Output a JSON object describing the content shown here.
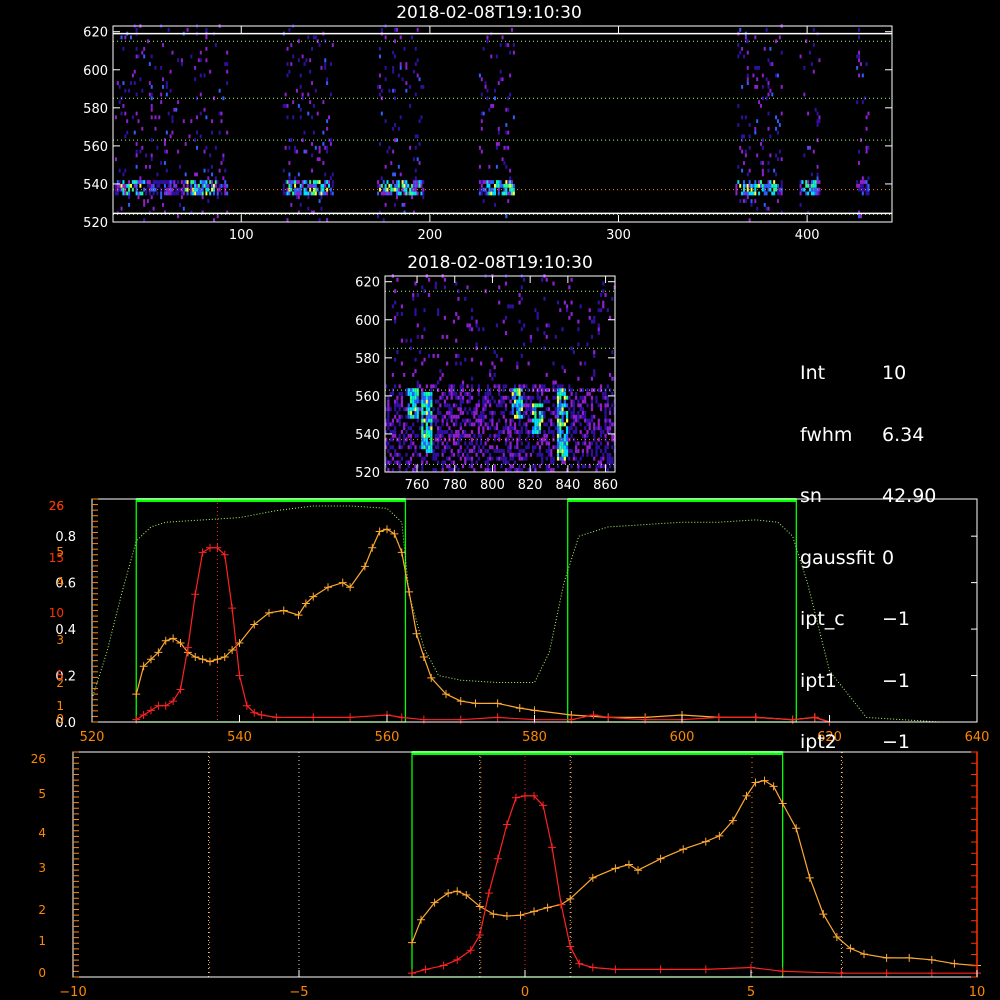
{
  "colors": {
    "background": "#000000",
    "axis": "#ffffff",
    "grid_dotted_green": "#9aff66",
    "grid_dotted_orange": "#ff8800",
    "window_green": "#00ff00",
    "red_profile": "#ff2222",
    "orange_profile": "#ffaa33",
    "green_dotted_profile": "#aaff66",
    "right_axis_red": "#ff3300",
    "left_axis_orange": "#ff8800",
    "heat_low": "#3010a0",
    "heat_mid": "#9020d0",
    "heat_high": "#00e0ff",
    "heat_peak": "#ffff40"
  },
  "info_panel": [
    {
      "key": "Int",
      "value": "10"
    },
    {
      "key": "fwhm",
      "value": "6.34"
    },
    {
      "key": "sn",
      "value": "42.90"
    },
    {
      "key": "gaussfit",
      "value": "0"
    },
    {
      "key": "ipt_c",
      "value": "−1"
    },
    {
      "key": "ipt1",
      "value": "−1"
    },
    {
      "key": "ipt2",
      "value": "−1"
    }
  ],
  "chart_data": [
    {
      "id": "top-spectrogram",
      "type": "heatmap",
      "title": "2018-02-08T19:10:30",
      "xlim": [
        32,
        445
      ],
      "ylim": [
        520,
        623
      ],
      "xticks": [
        "100",
        "200",
        "300",
        "400"
      ],
      "xtick_values": [
        100,
        200,
        300,
        400
      ],
      "yticks": [
        "520",
        "540",
        "560",
        "580",
        "600",
        "620"
      ],
      "ytick_values": [
        520,
        540,
        560,
        580,
        600,
        620
      ],
      "hlines_green": [
        524,
        563,
        585,
        615
      ],
      "hline_orange": 537,
      "hline_white": [
        524.5,
        619
      ],
      "emission_band_y": [
        533,
        541
      ],
      "active_segments": [
        [
          32,
          92
        ],
        [
          122,
          148
        ],
        [
          172,
          196
        ],
        [
          226,
          244
        ],
        [
          362,
          386
        ],
        [
          396,
          406
        ],
        [
          426,
          432
        ]
      ],
      "bright_segments": [
        [
          36,
          48
        ],
        [
          70,
          86
        ],
        [
          124,
          146
        ],
        [
          173,
          195
        ],
        [
          230,
          244
        ],
        [
          362,
          383
        ],
        [
          397,
          405
        ]
      ]
    },
    {
      "id": "zoom-spectrogram",
      "type": "heatmap",
      "title": "2018-02-08T19:10:30",
      "xlim": [
        743,
        865
      ],
      "ylim": [
        520,
        623
      ],
      "xticks": [
        "760",
        "780",
        "800",
        "820",
        "840",
        "860"
      ],
      "xtick_values": [
        760,
        780,
        800,
        820,
        840,
        860
      ],
      "yticks": [
        "520",
        "540",
        "560",
        "580",
        "600",
        "620"
      ],
      "ytick_values": [
        520,
        540,
        560,
        580,
        600,
        620
      ],
      "hlines_green": [
        524,
        563,
        585,
        615
      ],
      "hline_orange": 537,
      "bright_streaks": [
        [
          757,
          563,
          548
        ],
        [
          765,
          560,
          530
        ],
        [
          813,
          563,
          548
        ],
        [
          837,
          563,
          525
        ],
        [
          823,
          555,
          540
        ]
      ]
    },
    {
      "id": "profile-wavelength",
      "type": "line",
      "xlim": [
        520,
        640
      ],
      "xticks": [
        "520",
        "540",
        "560",
        "580",
        "600",
        "620",
        "640"
      ],
      "xtick_values": [
        520,
        540,
        560,
        580,
        600,
        620,
        640
      ],
      "yticks_left_white": [
        "0.0",
        "0.2",
        "0.4",
        "0.6",
        "0.8"
      ],
      "ytick_left_values": [
        0,
        0.2,
        0.4,
        0.6,
        0.8
      ],
      "yticks_left_orange": [
        "0",
        "1",
        "2",
        "3",
        "4",
        "5",
        "26"
      ],
      "yticks_left_red": [
        "5",
        "10",
        "15",
        "26"
      ],
      "ylim": [
        0,
        0.96
      ],
      "windows": [
        [
          526,
          562.5
        ],
        [
          584.5,
          615.5
        ]
      ],
      "marker_vline_red": 537,
      "series": [
        {
          "id": "red",
          "x": [
            526,
            527,
            528,
            529,
            530,
            531,
            532,
            533,
            534,
            535,
            536,
            537,
            538,
            539,
            540,
            541,
            542,
            543,
            545,
            550,
            555,
            560,
            562,
            565,
            570,
            575,
            580,
            585,
            588,
            590,
            595,
            600,
            605,
            610,
            615,
            618,
            620
          ],
          "y": [
            0.01,
            0.03,
            0.05,
            0.07,
            0.07,
            0.09,
            0.14,
            0.32,
            0.55,
            0.73,
            0.75,
            0.75,
            0.72,
            0.49,
            0.2,
            0.07,
            0.04,
            0.03,
            0.02,
            0.02,
            0.02,
            0.03,
            0.02,
            0.01,
            0.01,
            0.02,
            0.01,
            0.01,
            0.03,
            0.02,
            0.01,
            0.01,
            0.02,
            0.02,
            0.01,
            0.02,
            0.0
          ]
        },
        {
          "id": "orange",
          "x": [
            526,
            527,
            528,
            529,
            530,
            531,
            532,
            533,
            534,
            535,
            536,
            537,
            538,
            539,
            540,
            542,
            544,
            546,
            548,
            549,
            550,
            552,
            554,
            555,
            557,
            558,
            559,
            560,
            561,
            562,
            563,
            564,
            565,
            566,
            568,
            570,
            572,
            575,
            578,
            580,
            585,
            590,
            595,
            600,
            605,
            610,
            615,
            618,
            620
          ],
          "y": [
            0.12,
            0.24,
            0.27,
            0.3,
            0.35,
            0.36,
            0.34,
            0.3,
            0.28,
            0.27,
            0.26,
            0.27,
            0.28,
            0.31,
            0.34,
            0.42,
            0.47,
            0.48,
            0.46,
            0.51,
            0.54,
            0.58,
            0.6,
            0.58,
            0.67,
            0.75,
            0.82,
            0.83,
            0.81,
            0.73,
            0.56,
            0.38,
            0.28,
            0.19,
            0.12,
            0.09,
            0.08,
            0.08,
            0.06,
            0.05,
            0.03,
            0.02,
            0.02,
            0.03,
            0.02,
            0.02,
            0.01,
            0.02,
            0.0
          ]
        },
        {
          "id": "filter-transmission",
          "x": [
            520,
            522,
            524,
            526,
            528,
            530,
            535,
            540,
            545,
            550,
            555,
            560,
            562,
            563,
            565,
            567,
            570,
            575,
            580,
            582,
            584,
            586,
            590,
            595,
            600,
            605,
            610,
            613,
            615,
            617,
            620,
            625,
            630,
            635,
            640
          ],
          "y": [
            0.1,
            0.3,
            0.55,
            0.78,
            0.84,
            0.86,
            0.87,
            0.88,
            0.91,
            0.93,
            0.93,
            0.92,
            0.86,
            0.55,
            0.32,
            0.2,
            0.18,
            0.17,
            0.17,
            0.3,
            0.6,
            0.8,
            0.84,
            0.85,
            0.86,
            0.86,
            0.87,
            0.86,
            0.8,
            0.6,
            0.22,
            0.02,
            0.01,
            0.0,
            0.0
          ]
        }
      ]
    },
    {
      "id": "profile-velocity",
      "type": "line",
      "xlim": [
        -10,
        10
      ],
      "xticks": [
        "−10",
        "−5",
        "0",
        "5",
        "10"
      ],
      "xtick_values": [
        -10,
        -5,
        0,
        5,
        10
      ],
      "yticks_left_white": [
        "0",
        "1",
        "2",
        "3",
        "4",
        "5",
        "26"
      ],
      "ytick_left_values": [
        0,
        1,
        2,
        3,
        4,
        5,
        5.9
      ],
      "ylim": [
        0,
        5.9
      ],
      "window": [
        -2.5,
        5.7
      ],
      "dotted_vlines_white": [
        -7,
        -5,
        -1,
        1,
        7
      ],
      "dotted_vlines_orange": [
        -7,
        -1,
        1,
        5,
        7
      ],
      "marker_vline_red": 0,
      "series": [
        {
          "id": "red",
          "x": [
            -2.5,
            -2.2,
            -1.8,
            -1.5,
            -1.2,
            -1.0,
            -0.8,
            -0.6,
            -0.4,
            -0.2,
            0.0,
            0.2,
            0.4,
            0.6,
            0.8,
            1.0,
            1.2,
            1.5,
            2.0,
            3.0,
            4.0,
            5.0,
            5.7,
            7.0,
            8.0,
            9.0,
            10.0
          ],
          "y": [
            0.1,
            0.2,
            0.3,
            0.45,
            0.7,
            1.1,
            2.2,
            3.1,
            4.0,
            4.7,
            4.75,
            4.75,
            4.5,
            3.4,
            1.9,
            0.8,
            0.35,
            0.25,
            0.2,
            0.2,
            0.2,
            0.25,
            0.15,
            0.1,
            0.1,
            0.1,
            0.1
          ]
        },
        {
          "id": "orange",
          "x": [
            -2.5,
            -2.3,
            -2.0,
            -1.7,
            -1.5,
            -1.3,
            -1.0,
            -0.7,
            -0.4,
            -0.1,
            0.2,
            0.5,
            0.8,
            1.0,
            1.5,
            2.0,
            2.3,
            2.5,
            3.0,
            3.5,
            4.0,
            4.3,
            4.6,
            4.9,
            5.1,
            5.3,
            5.5,
            5.7,
            6.0,
            6.3,
            6.6,
            6.9,
            7.2,
            7.5,
            8.0,
            8.5,
            9.0,
            9.5,
            10.0
          ],
          "y": [
            0.9,
            1.5,
            1.95,
            2.2,
            2.25,
            2.15,
            1.85,
            1.65,
            1.6,
            1.62,
            1.72,
            1.82,
            1.9,
            2.05,
            2.6,
            2.85,
            2.95,
            2.8,
            3.1,
            3.35,
            3.55,
            3.7,
            4.1,
            4.75,
            5.1,
            5.15,
            5.0,
            4.55,
            3.9,
            2.6,
            1.65,
            1.05,
            0.75,
            0.6,
            0.5,
            0.5,
            0.45,
            0.35,
            0.3
          ]
        }
      ]
    }
  ]
}
